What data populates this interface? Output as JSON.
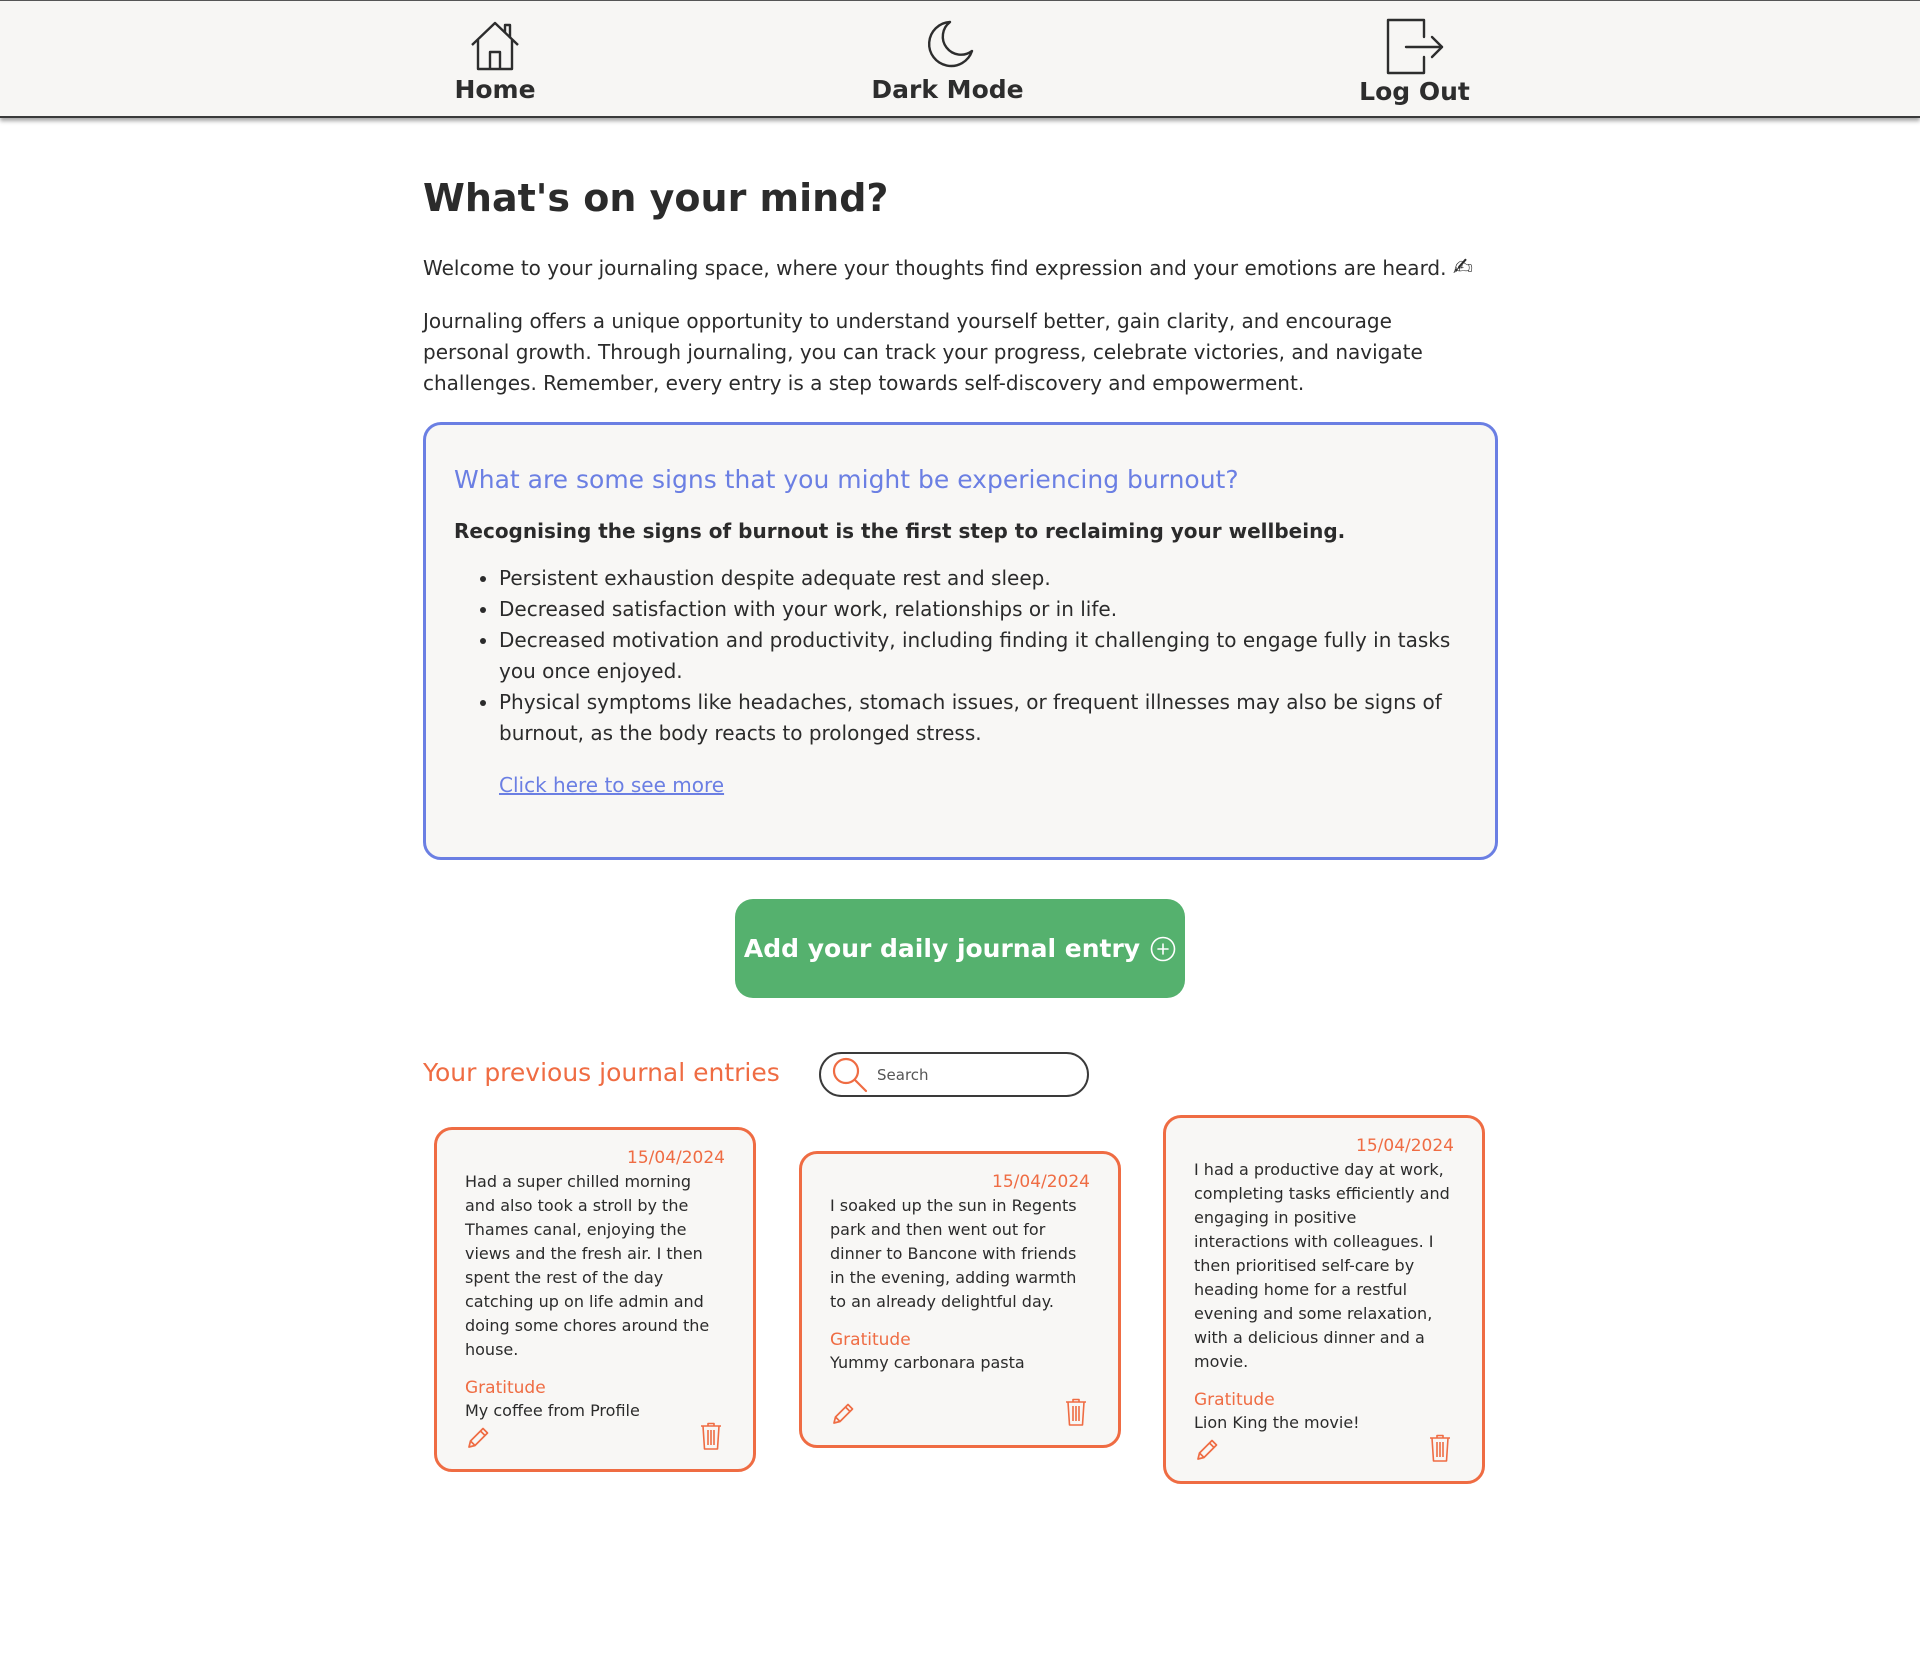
{
  "nav": {
    "home": {
      "label": "Home",
      "icon": "house-icon"
    },
    "dark_mode": {
      "label": "Dark Mode",
      "icon": "moon-icon"
    },
    "log_out": {
      "label": "Log Out",
      "icon": "logout-icon"
    }
  },
  "main": {
    "title": "What's on your mind?",
    "intro": "Welcome to your journaling space, where your thoughts find expression and your emotions are heard.",
    "intro_emoji": "✍",
    "intro_2": "Journaling offers a unique opportunity to understand yourself better, gain clarity, and encourage personal growth. Through journaling, you can track your progress, celebrate victories, and navigate challenges. Remember, every entry is a step towards self-discovery and empowerment."
  },
  "info": {
    "title": "What are some signs that you might be experiencing burnout?",
    "subtitle": "Recognising the signs of burnout is the first step to reclaiming your wellbeing.",
    "items": [
      "Persistent exhaustion despite adequate rest and sleep.",
      "Decreased satisfaction with your work, relationships or in life.",
      "Decreased motivation and productivity, including finding it challenging to engage fully in tasks you once enjoyed.",
      "Physical symptoms like headaches, stomach issues, or frequent illnesses may also be signs of burnout, as the body reacts to prolonged stress."
    ],
    "link": "Click here to see more"
  },
  "add_button": {
    "label": "Add your daily journal entry",
    "icon": "plus-circle-icon"
  },
  "entries_section": {
    "title": "Your previous journal entries",
    "search_placeholder": "Search"
  },
  "entries": [
    {
      "date": "15/04/2024",
      "text": "Had a super chilled morning and also took a stroll by the Thames canal, enjoying the views and the fresh air. I then spent the rest of the day catching up on life admin and doing some chores around the house.",
      "gratitude_label": "Gratitude",
      "gratitude": "My coffee from Profile"
    },
    {
      "date": "15/04/2024",
      "text": "I soaked up the sun in Regents park and then went out for dinner to Bancone with friends in the evening, adding warmth to an already delightful day.",
      "gratitude_label": "Gratitude",
      "gratitude": "Yummy carbonara pasta"
    },
    {
      "date": "15/04/2024",
      "text": "I had a productive day at work, completing tasks efficiently and engaging in positive interactions with colleagues. I then prioritised self-care by heading home for a restful evening and some relaxation, with a delicious dinner and a movie.",
      "gratitude_label": "Gratitude",
      "gratitude": "Lion King the movie!"
    }
  ],
  "colors": {
    "accent_blue": "#6b7fe3",
    "accent_orange": "#ef6c43",
    "button_green": "#55b16e",
    "nav_bg": "#f7f6f4",
    "card_bg": "#f8f7f5"
  }
}
